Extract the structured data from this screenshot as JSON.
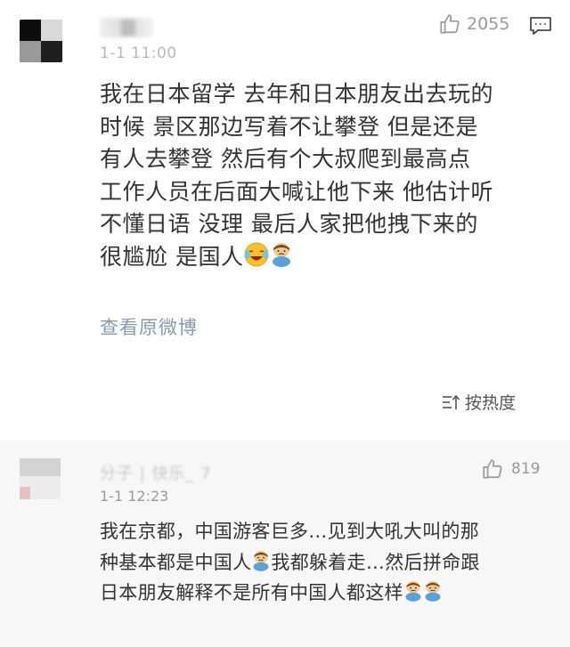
{
  "post": {
    "time": "1-1 11:00",
    "like_count": "2055",
    "icons": {
      "avatar": "avatar-blurred",
      "like": "thumbs-up-icon",
      "comment": "comment-icon"
    },
    "body_lines": [
      "我在日本留学 去年和日本朋友出去玩的",
      "时候 景区那边写着不让攀登 但是还是",
      "有人去攀登 然后有个大叔爬到最高点",
      "工作人员在后面大喊让他下来 他估计听",
      "不懂日语 没理 最后人家把他拽下来的",
      "很尴尬 是国人"
    ],
    "view_original": "查看原微博",
    "sort_label": "按热度"
  },
  "reply": {
    "name": "分子 | 快乐_ 7",
    "time": "1-1 12:23",
    "like_count": "819",
    "body_lines": [
      "我在京都，中国游客巨多…见到大吼大叫的那",
      "种基本都是中国人",
      "我都躲着走…然后拼命跟",
      "日本朋友解释不是所有中国人都这样"
    ]
  },
  "colors": {
    "link": "#8a9aab",
    "text": "#333333",
    "meta": "#9a9a9a",
    "reply_bg": "#f7f7f7"
  }
}
